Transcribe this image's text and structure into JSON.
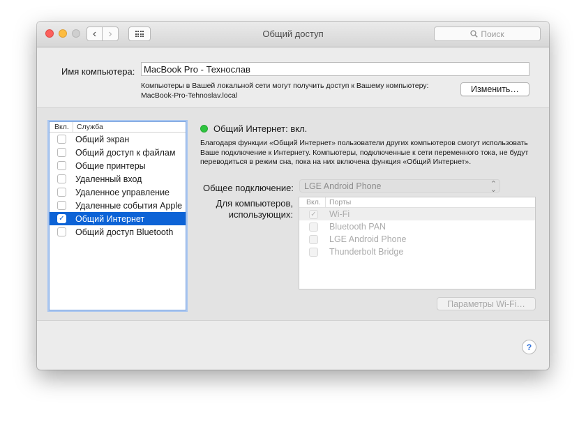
{
  "window": {
    "title": "Общий доступ",
    "search_placeholder": "Поиск",
    "nav_back": "‹",
    "nav_forward": "›"
  },
  "computer_name": {
    "label": "Имя компьютера:",
    "value": "MacBook Pro - Техноcлав",
    "description_line1": "Компьютеры в Вашей локальной сети могут получить доступ к Вашему компьютеру:",
    "description_line2": "MacBook-Pro-Tehnoslav.local",
    "change_button": "Изменить…"
  },
  "services": {
    "header_on": "Вкл.",
    "header_name": "Служба",
    "items": [
      {
        "label": "Общий экран",
        "checked": false,
        "selected": false
      },
      {
        "label": "Общий доступ к файлам",
        "checked": false,
        "selected": false
      },
      {
        "label": "Общие принтеры",
        "checked": false,
        "selected": false
      },
      {
        "label": "Удаленный вход",
        "checked": false,
        "selected": false
      },
      {
        "label": "Удаленное управление",
        "checked": false,
        "selected": false
      },
      {
        "label": "Удаленные события Apple",
        "checked": false,
        "selected": false
      },
      {
        "label": "Общий Интернет",
        "checked": true,
        "selected": true
      },
      {
        "label": "Общий доступ Bluetooth",
        "checked": false,
        "selected": false
      }
    ]
  },
  "internet_sharing": {
    "status": "Общий Интернет: вкл.",
    "status_color": "#2ec43f",
    "description": "Благодаря функции «Общий Интернет» пользователи других компьютеров смогут использовать Ваше подключение к Интернету. Компьютеры, подключенные к сети переменного тока, не будут переводиться в режим сна, пока на них включена функция «Общий Интернет».",
    "share_from_label": "Общее подключение:",
    "share_from_value": "LGE Android Phone",
    "ports_label_line1": "Для компьютеров,",
    "ports_label_line2": "использующих:",
    "ports_header_on": "Вкл.",
    "ports_header_name": "Порты",
    "ports": [
      {
        "label": "Wi-Fi",
        "checked": true
      },
      {
        "label": "Bluetooth PAN",
        "checked": false
      },
      {
        "label": "LGE Android Phone",
        "checked": false
      },
      {
        "label": "Thunderbolt Bridge",
        "checked": false
      }
    ],
    "wifi_button": "Параметры Wi-Fi…"
  },
  "help_label": "?",
  "accent_color": "#0d63d6"
}
